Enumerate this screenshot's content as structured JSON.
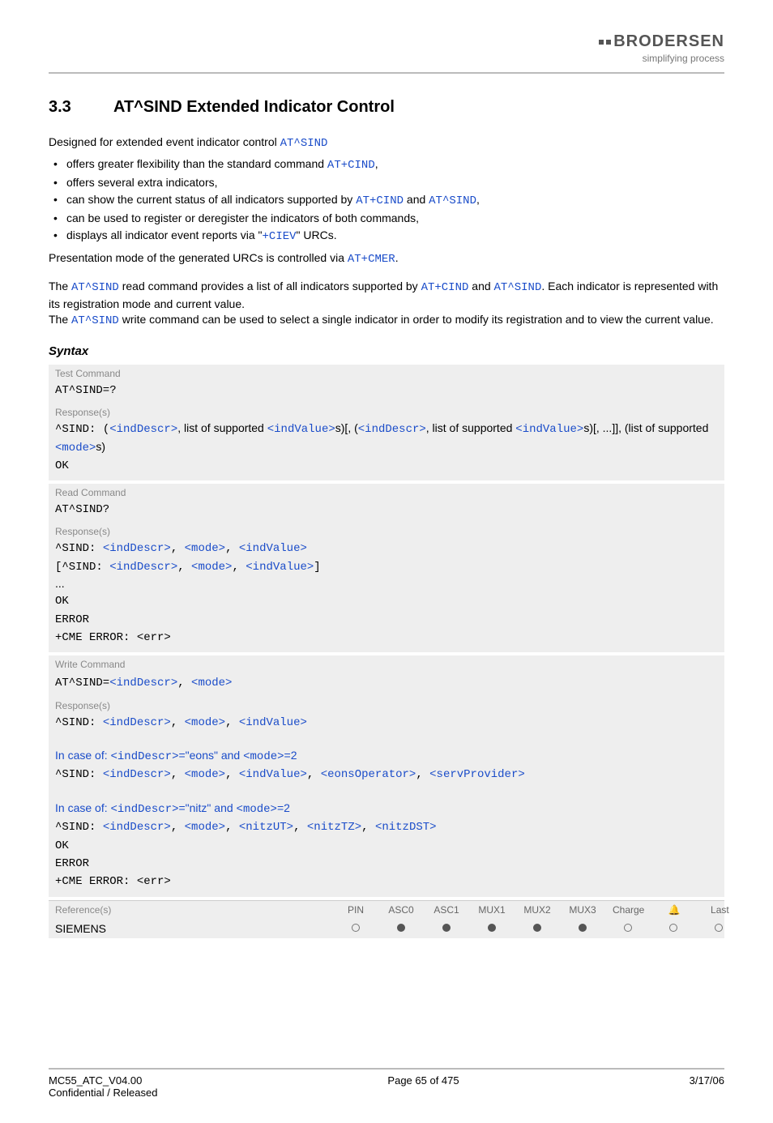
{
  "header": {
    "logo": "BRODERSEN",
    "tagline": "simplifying process"
  },
  "section": {
    "number": "3.3",
    "title": "AT^SIND   Extended Indicator Control"
  },
  "intro": {
    "lead": "Designed for extended event indicator control ",
    "lead_cmd": "AT^SIND",
    "bullets": [
      {
        "pre": "offers greater flexibility than the standard command ",
        "cmd": "AT+CIND",
        "post": ","
      },
      {
        "pre": "offers several extra indicators,",
        "cmd": "",
        "post": ""
      },
      {
        "pre": "can show the current status of all indicators supported by ",
        "cmd": "AT+CIND",
        "mid": " and ",
        "cmd2": "AT^SIND",
        "post": ","
      },
      {
        "pre": "can be used to register or deregister the indicators of both commands,",
        "cmd": "",
        "post": ""
      },
      {
        "pre": "displays all indicator event reports via \"",
        "cmd": "+CIEV",
        "post": "\" URCs."
      }
    ],
    "presentation_pre": "Presentation mode of the generated URCs is controlled via ",
    "presentation_cmd": "AT+CMER",
    "presentation_post": "."
  },
  "para2": {
    "t1": "The ",
    "c1": "AT^SIND",
    "t2": " read command provides a list of all indicators supported by ",
    "c2": "AT+CIND",
    "t3": " and ",
    "c3": "AT^SIND",
    "t4": ". Each indicator is represented with its registration mode and current value.",
    "t5": "The ",
    "c4": "AT^SIND",
    "t6": " write command can be used to select a single indicator in order to modify its registration and to view the current value."
  },
  "syntax_label": "Syntax",
  "labels": {
    "test": "Test Command",
    "read": "Read Command",
    "write": "Write Command",
    "response": "Response(s)",
    "reference": "Reference(s)"
  },
  "test_block": {
    "cmd": "AT^SIND=?",
    "resp_prefix": "^SIND: ",
    "resp_open": "(",
    "indDescr": "<indDescr>",
    "resp_mid1": ", list of supported ",
    "indValue": "<indValue>",
    "resp_mid2": "s)[, (",
    "resp_mid3": ", list of supported ",
    "resp_mid4": "s)[, ...]], (list of supported ",
    "mode": "<mode>",
    "resp_end": "s)",
    "ok": "OK"
  },
  "read_block": {
    "cmd": "AT^SIND?",
    "l1a": "^SIND: ",
    "indDescr": "<indDescr>",
    "mode": "<mode>",
    "indValue": "<indValue>",
    "l2a": "[^SIND: ",
    "dots": "...",
    "ok": "OK",
    "error": "ERROR",
    "cme": "+CME ERROR: <err>"
  },
  "write_block": {
    "cmd_pre": "AT^SIND=",
    "indDescr": "<indDescr>",
    "mode": "<mode>",
    "indValue": "<indValue>",
    "eonsOperator": "<eonsOperator>",
    "servProvider": "<servProvider>",
    "nitzUT": "<nitzUT>",
    "nitzTZ": "<nitzTZ>",
    "nitzDST": "<nitzDST>",
    "l1": "^SIND: ",
    "case1_pre": "In case of: ",
    "case1_mid": "=\"eons\" and ",
    "case1_end": "=2",
    "case2_mid": "=\"nitz\" and ",
    "ok": "OK",
    "error": "ERROR",
    "cme": "+CME ERROR: <err>"
  },
  "ref_table": {
    "cols": [
      "PIN",
      "ASC0",
      "ASC1",
      "MUX1",
      "MUX2",
      "MUX3",
      "Charge",
      "🔔",
      "Last"
    ],
    "row_label": "SIEMENS",
    "row_values": [
      "open",
      "fill",
      "fill",
      "fill",
      "fill",
      "fill",
      "open",
      "open",
      "open"
    ]
  },
  "footer": {
    "left1": "MC55_ATC_V04.00",
    "left2": "Confidential / Released",
    "center": "Page 65 of 475",
    "right": "3/17/06"
  }
}
